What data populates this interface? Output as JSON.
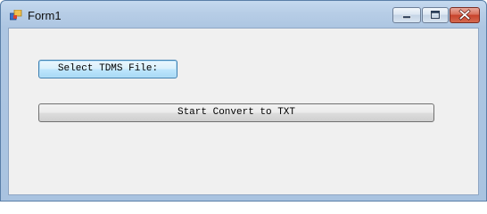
{
  "window": {
    "title": "Form1",
    "icon": "app-icon"
  },
  "title_controls": {
    "minimize_icon": "minimize-icon",
    "maximize_icon": "maximize-icon",
    "close_icon": "close-icon"
  },
  "form": {
    "select_button_label": "Select TDMS File:",
    "convert_button_label": "Start Convert to TXT"
  }
}
